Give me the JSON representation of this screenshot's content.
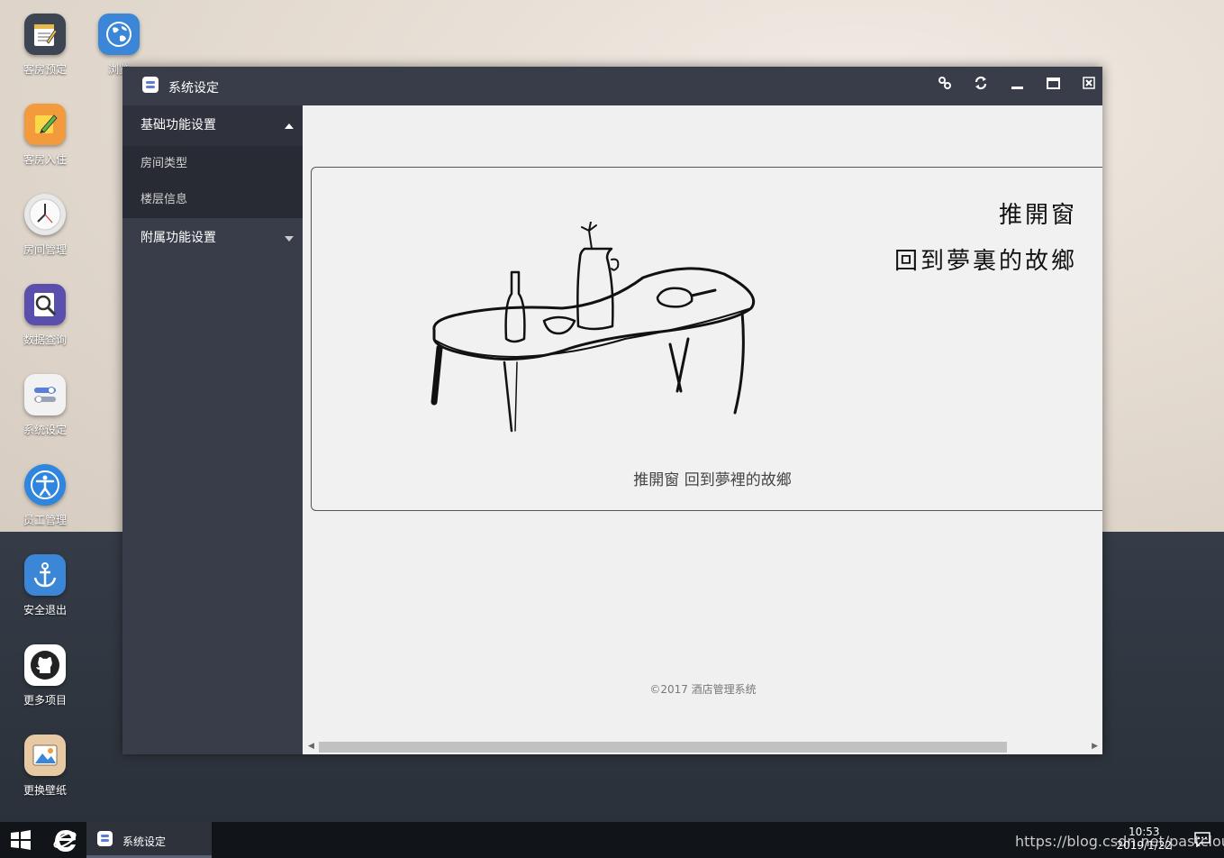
{
  "desktop": {
    "icons": [
      {
        "label": "客房预定"
      },
      {
        "label": "浏览"
      },
      {
        "label": "客房入住"
      },
      {
        "label": "房间管理"
      },
      {
        "label": "数据查询"
      },
      {
        "label": "系统设定"
      },
      {
        "label": "员工管理"
      },
      {
        "label": "安全退出"
      },
      {
        "label": "更多项目"
      },
      {
        "label": "更换壁纸"
      }
    ]
  },
  "window": {
    "title": "系统设定",
    "controls": [
      "link-icon",
      "refresh-icon",
      "minimize-icon",
      "maximize-icon",
      "close-icon"
    ],
    "sidebar": {
      "groups": [
        {
          "label": "基础功能设置",
          "expanded": true,
          "items": [
            {
              "label": "房间类型"
            },
            {
              "label": "楼层信息"
            }
          ]
        },
        {
          "label": "附属功能设置",
          "expanded": false,
          "items": []
        }
      ]
    },
    "content": {
      "poem_line1": "推開窗",
      "poem_line2": "回到夢裏的故鄉",
      "caption": "推開窗 回到夢裡的故鄉",
      "copyright": "©2017 酒店管理系统"
    }
  },
  "taskbar": {
    "task_label": "系统设定",
    "time": "10:53",
    "date": "2019/1/22",
    "watermark": "https://blog.csdn.net/pastclouds"
  }
}
